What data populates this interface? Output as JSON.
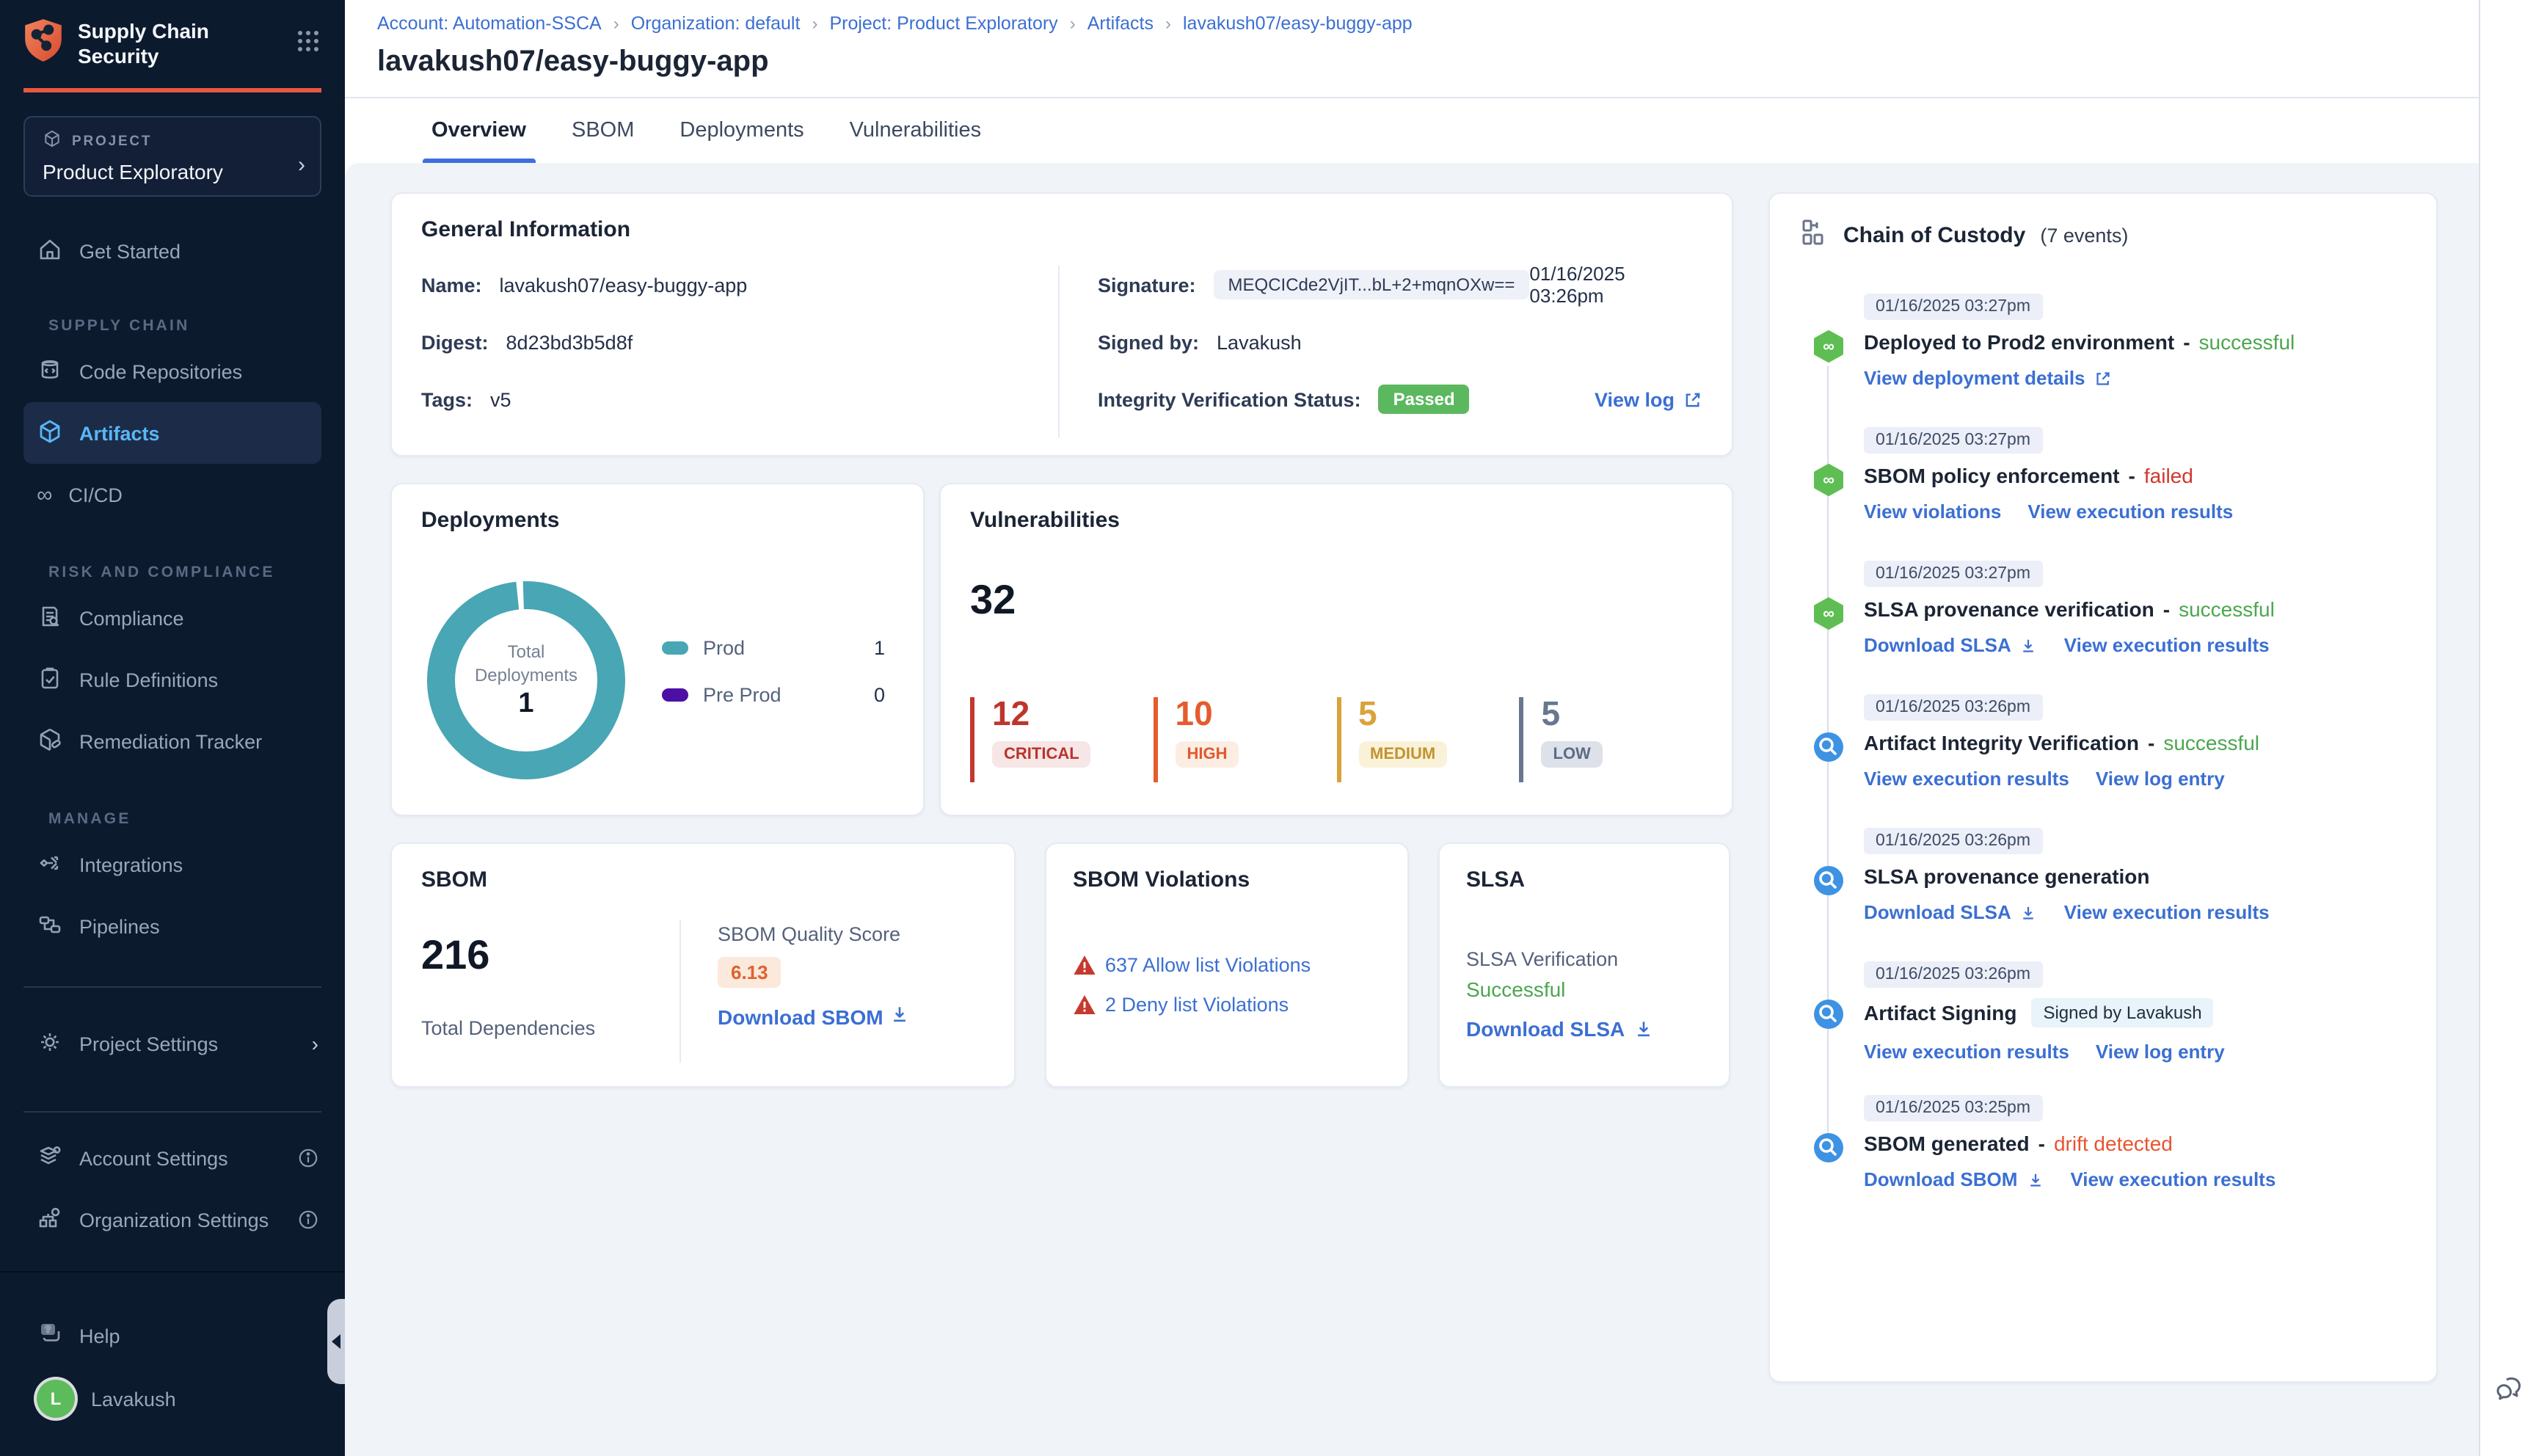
{
  "colors": {
    "brand_orange": "#E8583F",
    "link_blue": "#3B6FD3",
    "success_green": "#4CA64F",
    "failed_red": "#CE372E",
    "drift_orange": "#E8542F",
    "teal": "#49A6B4",
    "purple": "#4C10A6",
    "critical": "#BE352C",
    "high": "#E55B2D",
    "medium": "#D9A33C",
    "low": "#68778F",
    "passed_badge": "#5CB85F",
    "active_nav": "#58B7F6"
  },
  "sidebar": {
    "product_title": "Supply Chain Security",
    "project": {
      "label": "PROJECT",
      "name": "Product Exploratory"
    },
    "sections": {
      "supply_chain": "SUPPLY CHAIN",
      "risk": "RISK AND COMPLIANCE",
      "manage": "MANAGE"
    },
    "items": {
      "get_started": "Get Started",
      "code_repositories": "Code Repositories",
      "artifacts": "Artifacts",
      "cicd": "CI/CD",
      "compliance": "Compliance",
      "rule_definitions": "Rule Definitions",
      "remediation_tracker": "Remediation Tracker",
      "integrations": "Integrations",
      "pipelines": "Pipelines",
      "project_settings": "Project Settings",
      "account_settings": "Account Settings",
      "organization_settings": "Organization Settings",
      "help": "Help",
      "user_name": "Lavakush",
      "user_initial": "L"
    }
  },
  "breadcrumb": {
    "items": [
      "Account: Automation-SSCA",
      "Organization: default",
      "Project: Product Exploratory",
      "Artifacts",
      "lavakush07/easy-buggy-app"
    ]
  },
  "page": {
    "title": "lavakush07/easy-buggy-app",
    "tabs": [
      "Overview",
      "SBOM",
      "Deployments",
      "Vulnerabilities"
    ]
  },
  "general_info": {
    "title": "General Information",
    "name_label": "Name:",
    "name": "lavakush07/easy-buggy-app",
    "digest_label": "Digest:",
    "digest": "8d23bd3b5d8f",
    "tags_label": "Tags:",
    "tags": "v5",
    "signature_label": "Signature:",
    "signature": "MEQCICde2VjIT...bL+2+mqnOXw==",
    "signature_date": "01/16/2025 03:26pm",
    "signed_by_label": "Signed by:",
    "signed_by": "Lavakush",
    "integrity_label": "Integrity Verification Status:",
    "integrity_status": "Passed",
    "view_log": "View log"
  },
  "deployments": {
    "title": "Deployments",
    "center_label_1": "Total",
    "center_label_2": "Deployments",
    "total": "1",
    "legend": [
      {
        "name": "Prod",
        "value": "1",
        "color": "#49A6B4"
      },
      {
        "name": "Pre Prod",
        "value": "0",
        "color": "#4C10A6"
      }
    ]
  },
  "vulnerabilities": {
    "title": "Vulnerabilities",
    "total": "32",
    "severities": [
      {
        "count": "12",
        "label": "CRITICAL"
      },
      {
        "count": "10",
        "label": "HIGH"
      },
      {
        "count": "5",
        "label": "MEDIUM"
      },
      {
        "count": "5",
        "label": "LOW"
      }
    ]
  },
  "sbom": {
    "title": "SBOM",
    "total": "216",
    "total_label": "Total Dependencies",
    "quality_label": "SBOM Quality Score",
    "quality_score": "6.13",
    "download": "Download SBOM"
  },
  "sbom_violations": {
    "title": "SBOM Violations",
    "allow": "637 Allow list Violations",
    "deny": "2 Deny list Violations"
  },
  "slsa": {
    "title": "SLSA",
    "verification_label": "SLSA Verification",
    "verification_status": "Successful",
    "download": "Download SLSA"
  },
  "chain_of_custody": {
    "title": "Chain of Custody",
    "events_count": "(7 events)",
    "events": [
      {
        "timestamp": "01/16/2025 03:27pm",
        "title": "Deployed to Prod2 environment",
        "sep": "-",
        "status": "successful",
        "links": [
          "View deployment details"
        ]
      },
      {
        "timestamp": "01/16/2025 03:27pm",
        "title": "SBOM policy enforcement",
        "sep": "-",
        "status": "failed",
        "links": [
          "View violations",
          "View execution results"
        ]
      },
      {
        "timestamp": "01/16/2025 03:27pm",
        "title": "SLSA provenance verification",
        "sep": "-",
        "status": "successful",
        "links": [
          "Download SLSA",
          "View execution results"
        ]
      },
      {
        "timestamp": "01/16/2025 03:26pm",
        "title": "Artifact Integrity Verification",
        "sep": "-",
        "status": "successful",
        "links": [
          "View execution results",
          "View log entry"
        ]
      },
      {
        "timestamp": "01/16/2025 03:26pm",
        "title": "SLSA provenance generation",
        "sep": "",
        "status": "",
        "links": [
          "Download SLSA",
          "View execution results"
        ]
      },
      {
        "timestamp": "01/16/2025 03:26pm",
        "title": "Artifact Signing",
        "sep": "",
        "status": "",
        "badge": "Signed by Lavakush",
        "links": [
          "View execution results",
          "View log entry"
        ]
      },
      {
        "timestamp": "01/16/2025 03:25pm",
        "title": "SBOM generated",
        "sep": "-",
        "status": "drift detected",
        "links": [
          "Download SBOM",
          "View execution results"
        ]
      }
    ]
  }
}
